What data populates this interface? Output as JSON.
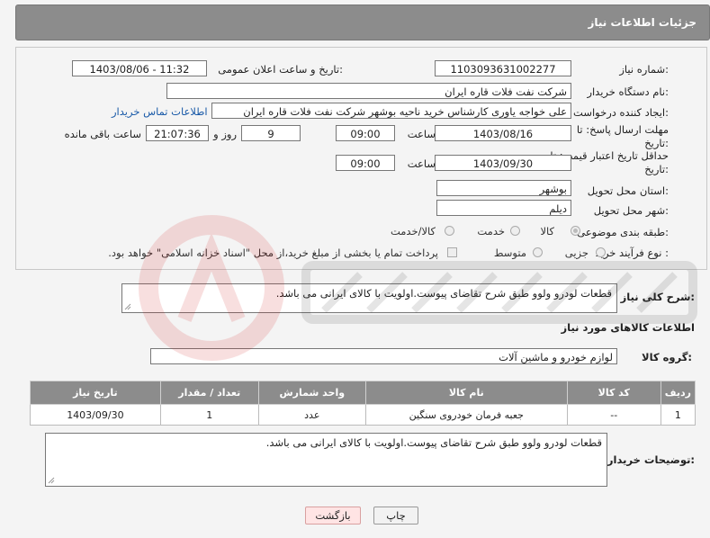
{
  "header": {
    "title": "جزئیات اطلاعات نیاز"
  },
  "form": {
    "need_number_label": "شماره نیاز:",
    "need_number": "1103093631002277",
    "announce_label": "تاریخ و ساعت اعلان عمومی:",
    "announce_value": "1403/08/06 - 11:32",
    "buyer_org_label": "نام دستگاه خریدار:",
    "buyer_org": "شرکت نفت فلات قاره ایران",
    "requester_label": "ایجاد کننده درخواست:",
    "requester": "علی خواجه یاوری کارشناس خرید ناحیه بوشهر  شرکت نفت فلات قاره ایران",
    "contact_link": "اطلاعات تماس خریدار",
    "deadline_label_1": "مهلت ارسال پاسخ: تا",
    "deadline_label_2": "تاریخ:",
    "deadline_date": "1403/08/16",
    "time_label": "ساعت",
    "deadline_time": "09:00",
    "days_value": "9",
    "days_label": "روز و",
    "remaining_time": "21:07:36",
    "remaining_label": "ساعت باقی مانده",
    "min_validity_label_1": "حداقل تاریخ اعتبار قیمت: تا",
    "min_validity_label_2": "تاریخ:",
    "validity_date": "1403/09/30",
    "validity_time": "09:00",
    "province_label": "استان محل تحویل:",
    "province": "بوشهر",
    "city_label": "شهر محل تحویل:",
    "city": "دیلم",
    "category_label": "طبقه بندی موضوعی:",
    "category_options": [
      "کالا",
      "خدمت",
      "کالا/خدمت"
    ],
    "category_selected": "کالا",
    "purchase_type_label": "نوع فرآیند خرید :",
    "purchase_options": [
      "جزیی",
      "متوسط"
    ],
    "payment_note": "پرداخت تمام یا بخشی از مبلغ خرید،از محل \"اسناد خزانه اسلامی\" خواهد بود."
  },
  "description": {
    "label": "شرح کلی نیاز:",
    "text": "قطعات لودرو ولوو طبق شرح تقاضای پیوست.اولویت با کالای ایرانی می باشد."
  },
  "goods_info": {
    "title": "اطلاعات کالاهای مورد نیاز",
    "group_label": "گروه کالا:",
    "group_value": "لوازم خودرو و ماشین آلات"
  },
  "items_table": {
    "headers": [
      "ردیف",
      "کد کالا",
      "نام کالا",
      "واحد شمارش",
      "تعداد / مقدار",
      "تاریخ نیاز"
    ],
    "rows": [
      [
        "1",
        "--",
        "جعبه فرمان خودروی سنگین",
        "عدد",
        "1",
        "1403/09/30"
      ]
    ]
  },
  "buyer_notes": {
    "label": "توضیحات خریدار:",
    "text": "قطعات لودرو ولوو طبق شرح تقاضای پیوست.اولویت با کالای ایرانی می باشد."
  },
  "buttons": {
    "print": "چاپ",
    "back": "بازگشت"
  },
  "colors": {
    "header_bg": "#8c8c8c",
    "link": "#1a5aa8",
    "back_button_bg": "#ffe4e4"
  }
}
